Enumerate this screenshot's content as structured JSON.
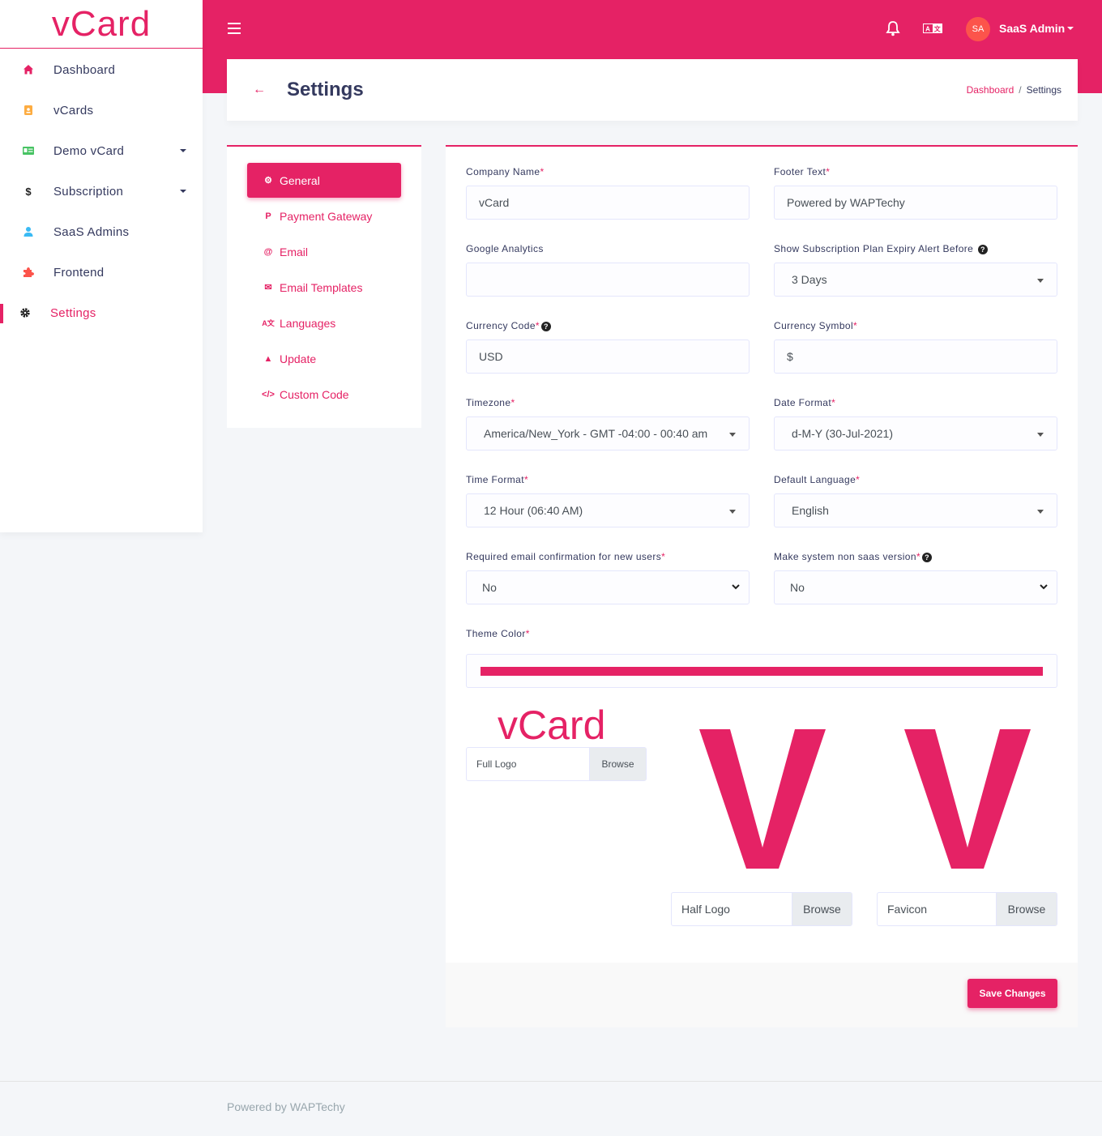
{
  "brand": {
    "name": "vCard"
  },
  "colors": {
    "accent": "#e52265",
    "avatar_bg": "#fc544b"
  },
  "topbar": {
    "menu_icon": "hamburger-icon",
    "notification_icon": "bell-icon",
    "language_icon": "translate-icon",
    "avatar_initials": "SA",
    "user_name": "SaaS Admin"
  },
  "sidebar": {
    "items": [
      {
        "label": "Dashboard",
        "icon": "home-icon",
        "color": "#e52265"
      },
      {
        "label": "vCards",
        "icon": "id-badge-icon",
        "color": "#fdac41"
      },
      {
        "label": "Demo vCard",
        "icon": "id-card-icon",
        "color": "#47c363",
        "has_caret": true
      },
      {
        "label": "Subscription",
        "icon": "dollar-icon",
        "color": "#222222",
        "has_caret": true
      },
      {
        "label": "SaaS Admins",
        "icon": "user-icon",
        "color": "#3abaf4"
      },
      {
        "label": "Frontend",
        "icon": "puzzle-icon",
        "color": "#fc544b"
      },
      {
        "label": "Settings",
        "icon": "gear-icon",
        "color": "#222222",
        "active": true
      }
    ]
  },
  "header": {
    "title": "Settings",
    "breadcrumb": [
      "Dashboard",
      "Settings"
    ],
    "separator": "/"
  },
  "settings_menu": [
    {
      "label": "General",
      "active": true
    },
    {
      "label": "Payment Gateway"
    },
    {
      "label": "Email"
    },
    {
      "label": "Email Templates"
    },
    {
      "label": "Languages"
    },
    {
      "label": "Update"
    },
    {
      "label": "Custom Code"
    }
  ],
  "form": {
    "company_name": {
      "label": "Company Name",
      "value": "vCard"
    },
    "footer_text": {
      "label": "Footer Text",
      "value": "Powered by WAPTechy"
    },
    "google_analytics": {
      "label": "Google Analytics",
      "value": ""
    },
    "expiry_alert": {
      "label": "Show Subscription Plan Expiry Alert Before",
      "value": "3 Days"
    },
    "currency_code": {
      "label": "Currency Code",
      "value": "USD"
    },
    "currency_symbol": {
      "label": "Currency Symbol",
      "value": "$"
    },
    "timezone": {
      "label": "Timezone",
      "value": "America/New_York - GMT -04:00 - 00:40 am"
    },
    "date_format": {
      "label": "Date Format",
      "value": "d-M-Y (30-Jul-2021)"
    },
    "time_format": {
      "label": "Time Format",
      "value": "12 Hour (06:40 AM)"
    },
    "default_language": {
      "label": "Default Language",
      "value": "English"
    },
    "email_confirmation": {
      "label": "Required email confirmation for new users",
      "value": "No"
    },
    "non_saas": {
      "label": "Make system non saas version",
      "value": "No"
    },
    "theme_color": {
      "label": "Theme Color",
      "value": "#e52265"
    },
    "required_mark": "*",
    "help_mark": "?",
    "full_logo": {
      "preview_text": "vCard",
      "file_label": "Full Logo",
      "browse": "Browse"
    },
    "half_logo": {
      "preview_text": "V",
      "file_label": "Half Logo",
      "browse": "Browse"
    },
    "favicon": {
      "preview_text": "V",
      "file_label": "Favicon",
      "browse": "Browse"
    },
    "save_label": "Save Changes"
  },
  "footer": {
    "text": "Powered by WAPTechy"
  }
}
